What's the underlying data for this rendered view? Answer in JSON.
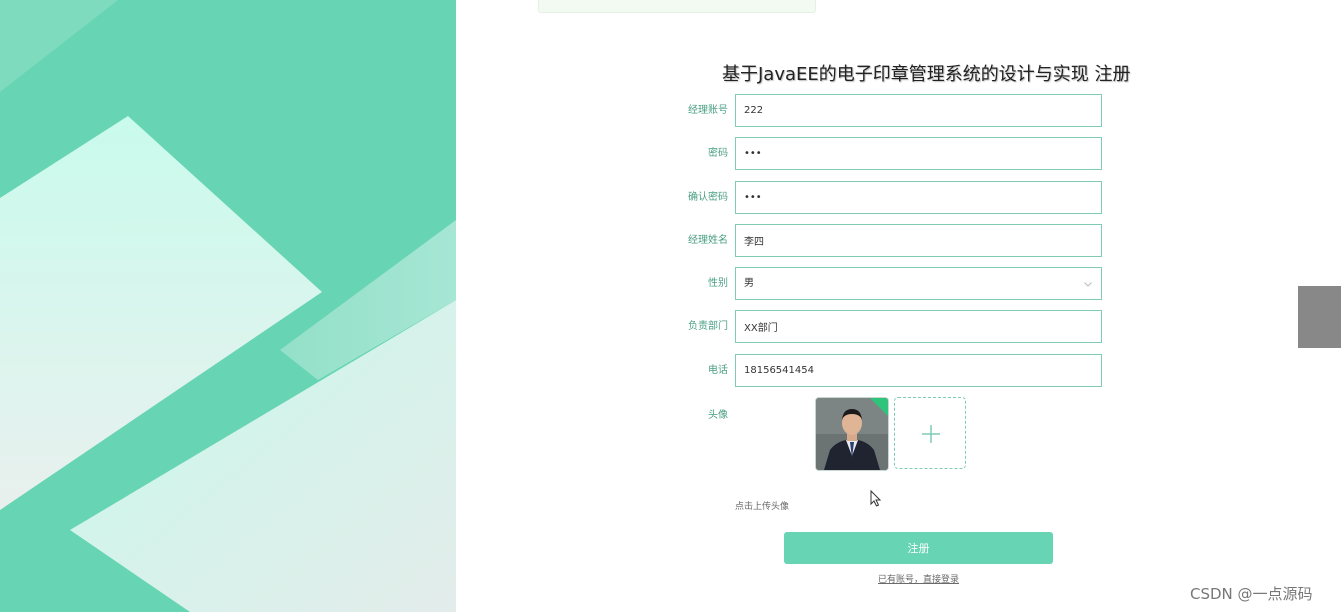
{
  "form": {
    "title": "基于JavaEE的电子印章管理系统的设计与实现 注册",
    "fields": [
      {
        "label": "经理账号",
        "value": "222"
      },
      {
        "label": "密码",
        "value": "•••"
      },
      {
        "label": "确认密码",
        "value": "•••"
      },
      {
        "label": "经理姓名",
        "value": "李四"
      },
      {
        "label": "性别",
        "value": "男"
      },
      {
        "label": "负责部门",
        "value": "XX部门"
      },
      {
        "label": "电话",
        "value": "18156541454"
      }
    ],
    "avatar_label": "头像",
    "upload_hint": "点击上传头像",
    "register_label": "注册",
    "login_link": "已有账号，直接登录"
  },
  "icons": {
    "chevron": "chevron-down-icon",
    "plus": "plus-icon",
    "cursor": "cursor-icon"
  },
  "colors": {
    "brand": "#67d4b3",
    "label": "#4a9f84",
    "border": "#7fcbb6"
  },
  "watermark": "CSDN @一点源码"
}
